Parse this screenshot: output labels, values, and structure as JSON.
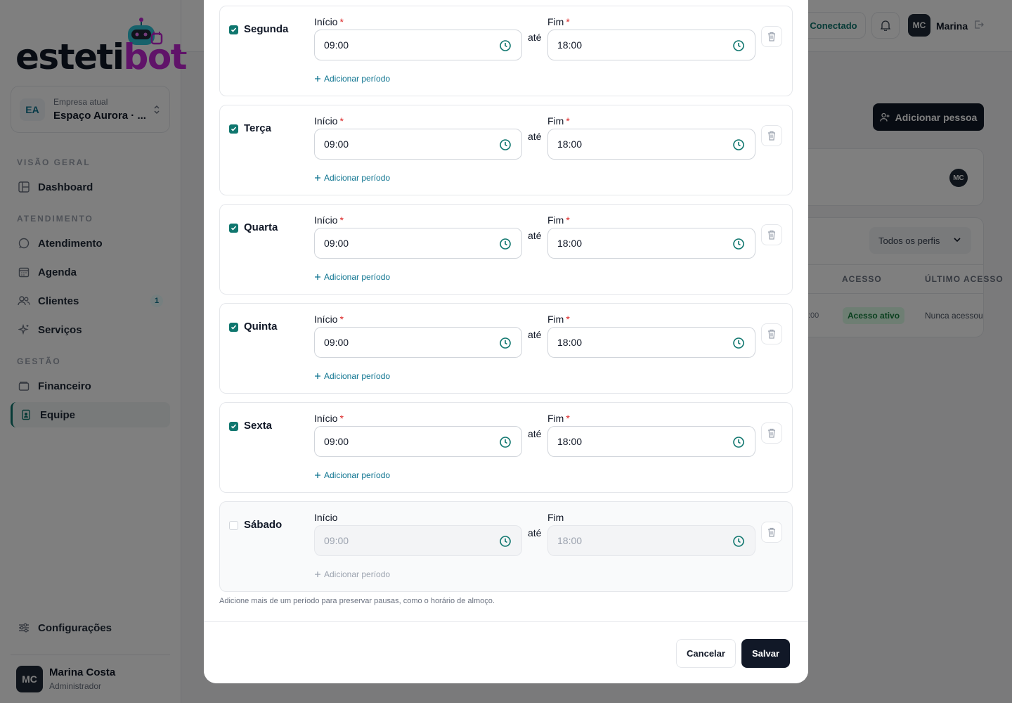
{
  "brand": {
    "logo_main": "esteti",
    "logo_accent": "bot"
  },
  "company": {
    "badge": "EA",
    "label": "Empresa atual",
    "value": "Espaço Aurora · ..."
  },
  "nav": {
    "sections": [
      "VISÃO GERAL",
      "ATENDIMENTO",
      "GESTÃO"
    ],
    "items": [
      {
        "label": "Dashboard",
        "icon": "layout-icon"
      },
      {
        "label": "Atendimento",
        "icon": "whatsapp-icon"
      },
      {
        "label": "Agenda",
        "icon": "calendar-icon"
      },
      {
        "label": "Clientes",
        "icon": "users-icon",
        "count": "1"
      },
      {
        "label": "Serviços",
        "icon": "sparkles-icon"
      },
      {
        "label": "Financeiro",
        "icon": "wallet-icon"
      },
      {
        "label": "Equipe",
        "icon": "id-badge-icon",
        "active": true
      },
      {
        "label": "Configurações",
        "icon": "sliders-icon"
      }
    ]
  },
  "user": {
    "initials": "MC",
    "name": "Marina Costa",
    "role": "Administrador"
  },
  "topbar": {
    "status": "Conectado",
    "initials": "MC",
    "name": "Marina"
  },
  "team": {
    "add_button": "Adicionar pessoa",
    "avatar_initials": "MC",
    "filter": "Todos os perfis",
    "columns": [
      "ACESSO",
      "ÚLTIMO ACESSO"
    ],
    "row": {
      "time": ":00",
      "access": "Acesso ativo",
      "last_access": "Nunca acessou"
    }
  },
  "schedule": {
    "ate": "até",
    "add_period": "Adicionar período",
    "days": [
      {
        "name": "Segunda",
        "enabled": true,
        "start_label": "Início",
        "end_label": "Fim",
        "start": "09:00",
        "end": "18:00"
      },
      {
        "name": "Terça",
        "enabled": true,
        "start_label": "Início",
        "end_label": "Fim",
        "start": "09:00",
        "end": "18:00"
      },
      {
        "name": "Quarta",
        "enabled": true,
        "start_label": "Início",
        "end_label": "Fim",
        "start": "09:00",
        "end": "18:00"
      },
      {
        "name": "Quinta",
        "enabled": true,
        "start_label": "Início",
        "end_label": "Fim",
        "start": "09:00",
        "end": "18:00"
      },
      {
        "name": "Sexta",
        "enabled": true,
        "start_label": "Início",
        "end_label": "Fim",
        "start": "09:00",
        "end": "18:00"
      },
      {
        "name": "Sábado",
        "enabled": false,
        "start_label": "Início",
        "end_label": "Fim",
        "start": "09:00",
        "end": "18:00"
      }
    ],
    "hint": "Adicione mais de um período para preservar pausas, como o horário de almoço."
  },
  "footer": {
    "cancel": "Cancelar",
    "save": "Salvar"
  },
  "colors": {
    "accent": "#0f766e",
    "link": "#0e7490",
    "primary_dark": "#111827",
    "required": "#dc2626",
    "brand_accent": "#c026d3"
  }
}
